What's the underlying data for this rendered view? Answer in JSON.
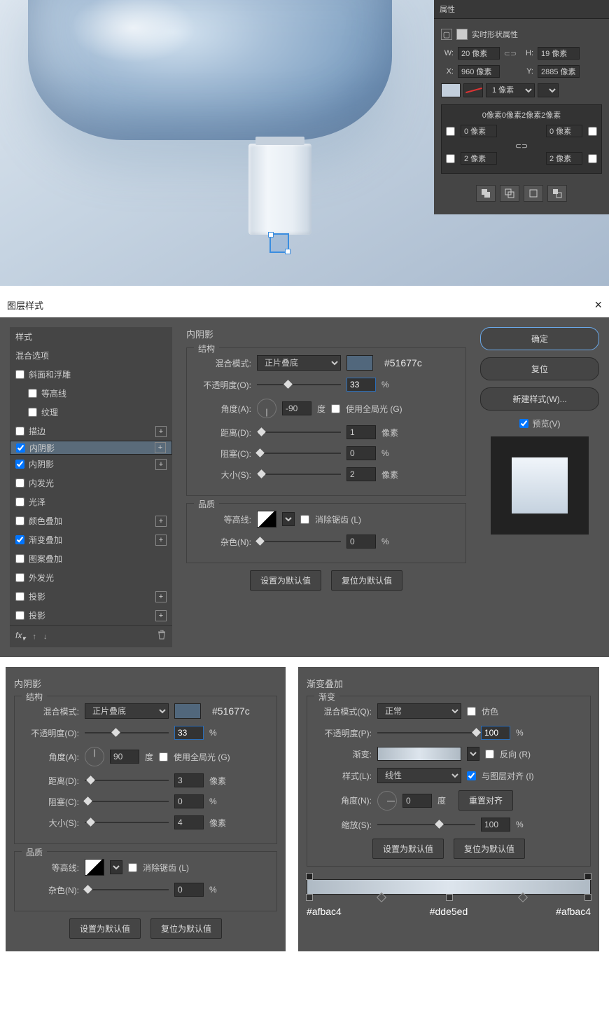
{
  "props": {
    "title": "属性",
    "subtitle": "实时形状属性",
    "w_label": "W:",
    "w_val": "20 像素",
    "h_label": "H:",
    "h_val": "19 像素",
    "x_label": "X:",
    "x_val": "960 像素",
    "y_label": "Y:",
    "y_val": "2885 像素",
    "stroke_val": "1 像素",
    "corners_summary": "0像素0像素2像素2像素",
    "tl": "0 像素",
    "tr": "0 像素",
    "bl": "2 像素",
    "br": "2 像素",
    "link": "⊂⊃"
  },
  "layerStyle": {
    "title": "图层样式",
    "left": {
      "style": "样式",
      "blend": "混合选项",
      "bevel": "斜面和浮雕",
      "contour": "等高线",
      "texture": "纹理",
      "stroke": "描边",
      "innerShadow": "内阴影",
      "innerShadow2": "内阴影",
      "innerGlow": "内发光",
      "satin": "光泽",
      "colorOverlay": "颜色叠加",
      "gradOverlay": "渐变叠加",
      "patternOverlay": "图案叠加",
      "outerGlow": "外发光",
      "drop1": "投影",
      "drop2": "投影"
    },
    "mid": {
      "panel": "内阴影",
      "struct": "结构",
      "blendMode": "混合模式:",
      "blendVal": "正片叠底",
      "hex": "#51677c",
      "opacity": "不透明度(O):",
      "opVal": "33",
      "pct": "%",
      "angle": "角度(A):",
      "angleVal": "-90",
      "deg": "度",
      "global": "使用全局光 (G)",
      "distance": "距离(D):",
      "distVal": "1",
      "px": "像素",
      "choke": "阻塞(C):",
      "chokeVal": "0",
      "size": "大小(S):",
      "sizeVal": "2",
      "quality": "品质",
      "contour": "等高线:",
      "anti": "消除锯齿 (L)",
      "noise": "杂色(N):",
      "noiseVal": "0",
      "setDefault": "设置为默认值",
      "resetDefault": "复位为默认值"
    },
    "right": {
      "ok": "确定",
      "reset": "复位",
      "newStyle": "新建样式(W)...",
      "preview": "预览(V)"
    }
  },
  "panel2": {
    "title": "内阴影",
    "struct": "结构",
    "blendMode": "混合模式:",
    "blendVal": "正片叠底",
    "hex": "#51677c",
    "opacity": "不透明度(O):",
    "opVal": "33",
    "pct": "%",
    "angle": "角度(A):",
    "angleVal": "90",
    "deg": "度",
    "global": "使用全局光 (G)",
    "distance": "距离(D):",
    "distVal": "3",
    "px": "像素",
    "choke": "阻塞(C):",
    "chokeVal": "0",
    "size": "大小(S):",
    "sizeVal": "4",
    "quality": "品质",
    "contour": "等高线:",
    "anti": "消除锯齿 (L)",
    "noise": "杂色(N):",
    "noiseVal": "0",
    "setDefault": "设置为默认值",
    "resetDefault": "复位为默认值"
  },
  "panel3": {
    "title": "渐变叠加",
    "grad": "渐变",
    "blendMode": "混合模式(Q):",
    "blendVal": "正常",
    "dither": "仿色",
    "opacity": "不透明度(P):",
    "opVal": "100",
    "pct": "%",
    "gradient": "渐变:",
    "reverse": "反向 (R)",
    "style": "样式(L):",
    "styleVal": "线性",
    "align": "与图层对齐 (I)",
    "angle": "角度(N):",
    "angleVal": "0",
    "deg": "度",
    "resetAlign": "重置对齐",
    "scale": "缩放(S):",
    "scaleVal": "100",
    "setDefault": "设置为默认值",
    "resetDefault": "复位为默认值",
    "stop1": "#afbac4",
    "stop2": "#dde5ed",
    "stop3": "#afbac4"
  }
}
